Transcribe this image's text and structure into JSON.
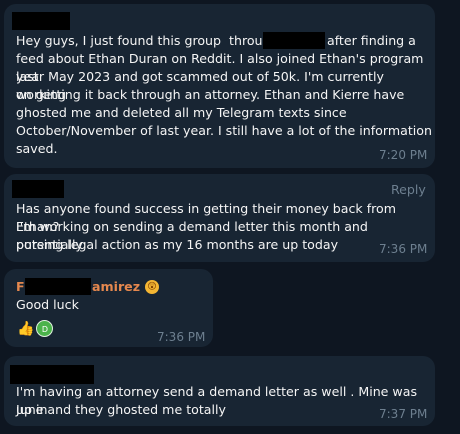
{
  "messages": [
    {
      "text_lines": [
        "Hey guys, I just found this group  through",
        "feed about Ethan Duran on Reddit. I also joined Ethan's program last",
        "year May 2023 and got scammed out of 50k. I'm currently working",
        "on getting it back through an attorney. Ethan and Kierre have",
        "ghosted me and deleted all my Telegram texts since",
        "October/November of last year. I still have a lot of the information",
        "saved."
      ],
      "text_after_redaction": "after finding a",
      "time": "7:20 PM"
    },
    {
      "reply_label": "Reply",
      "text_lines": [
        "Has anyone found success in getting their money back from Ethan?",
        "I'm working on sending a demand letter this month and potentially",
        "pursing legal action as my 16 months are up today"
      ],
      "time": "7:36 PM"
    },
    {
      "sender_initial": "F",
      "sender_suffix": "amirez",
      "sender_emoji": "😲",
      "text": "Good luck",
      "reaction_emoji": "👍",
      "reaction_avatar_initial": "D",
      "time": "7:36 PM"
    },
    {
      "text_lines": [
        "I'm having an attorney send a demand letter as well . Mine was up in",
        "June and they ghosted me totally"
      ],
      "time": "7:37 PM"
    }
  ]
}
